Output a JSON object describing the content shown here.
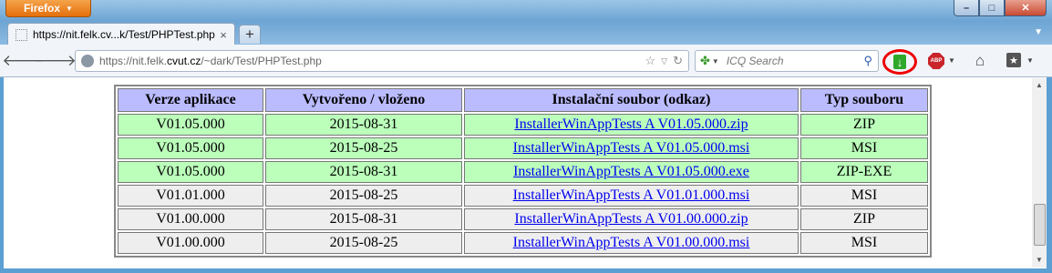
{
  "browser": {
    "menu_label": "Firefox",
    "tab": {
      "title": "https://nit.felk.cv...k/Test/PHPTest.php",
      "close": "×"
    },
    "new_tab": "+",
    "url": {
      "prefix": "https://nit.felk.",
      "host": "cvut.cz",
      "path": "/~dark/Test/PHPTest.php"
    },
    "search_placeholder": "ICQ Search",
    "highlight_color": "#e00000",
    "icons": [
      "back-icon",
      "forward-icon",
      "globe-icon",
      "star-icon",
      "reload-icon",
      "clover-icon",
      "search-icon",
      "download-icon",
      "adblock-icon",
      "home-icon",
      "bookmarks-icon"
    ]
  },
  "table": {
    "headers": [
      "Verze aplikace",
      "Vytvořeno / vloženo",
      "Instalační soubor (odkaz)",
      "Typ souboru"
    ],
    "rows": [
      {
        "version": "V01.05.000",
        "date": "2015-08-31",
        "file": "InstallerWinAppTests A V01.05.000.zip",
        "type": "ZIP",
        "color": "green"
      },
      {
        "version": "V01.05.000",
        "date": "2015-08-25",
        "file": "InstallerWinAppTests A V01.05.000.msi",
        "type": "MSI",
        "color": "green"
      },
      {
        "version": "V01.05.000",
        "date": "2015-08-31",
        "file": "InstallerWinAppTests A V01.05.000.exe",
        "type": "ZIP-EXE",
        "color": "green"
      },
      {
        "version": "V01.01.000",
        "date": "2015-08-25",
        "file": "InstallerWinAppTests A V01.01.000.msi",
        "type": "MSI",
        "color": "gray"
      },
      {
        "version": "V01.00.000",
        "date": "2015-08-31",
        "file": "InstallerWinAppTests A V01.00.000.zip",
        "type": "ZIP",
        "color": "gray"
      },
      {
        "version": "V01.00.000",
        "date": "2015-08-25",
        "file": "InstallerWinAppTests A V01.00.000.msi",
        "type": "MSI",
        "color": "gray"
      }
    ],
    "colors": {
      "header": "#bbbcff",
      "green": "#bbffbb",
      "gray": "#eeeeee"
    }
  }
}
